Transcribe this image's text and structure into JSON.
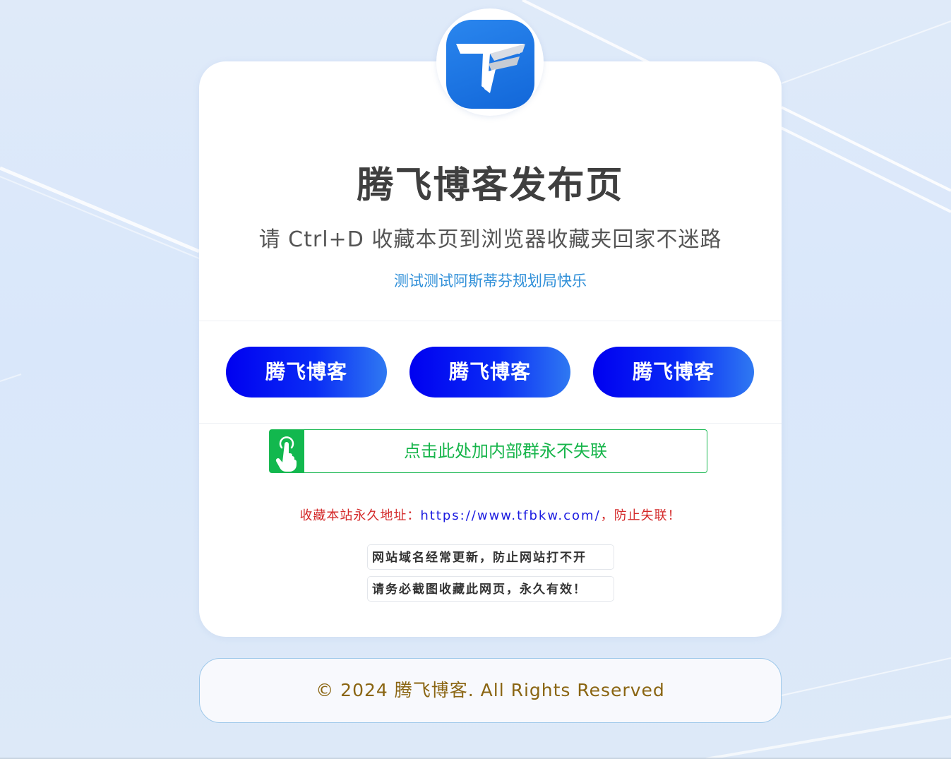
{
  "page": {
    "title": "腾飞博客发布页",
    "subtitle": "请 Ctrl+D 收藏本页到浏览器收藏夹回家不迷路",
    "tagline": "测试测试阿斯蒂芬规划局快乐"
  },
  "logo": {
    "icon": "tf-logo-icon",
    "color": "#1a74e4"
  },
  "buttons": [
    {
      "label": "腾飞博客"
    },
    {
      "label": "腾飞博客"
    },
    {
      "label": "腾飞博客"
    }
  ],
  "group": {
    "icon": "tap-hand-icon",
    "label": "点击此处加内部群永不失联",
    "color": "#17b54b"
  },
  "address": {
    "prefix": "收藏本站永久地址：",
    "url": "https://www.tfbkw.com/",
    "suffix": "，防止失联！"
  },
  "notices": [
    "网站域名经常更新，防止网站打不开",
    "请务必截图收藏此网页，永久有效！"
  ],
  "footer": {
    "text": "© 2024 腾飞博客. All Rights Reserved"
  },
  "colors": {
    "button_gradient_start": "#0000f0",
    "button_gradient_end": "#2f79f2",
    "footer_text": "#8a6512",
    "address_text": "#d42a2a",
    "url_text": "#1a1ae0"
  }
}
